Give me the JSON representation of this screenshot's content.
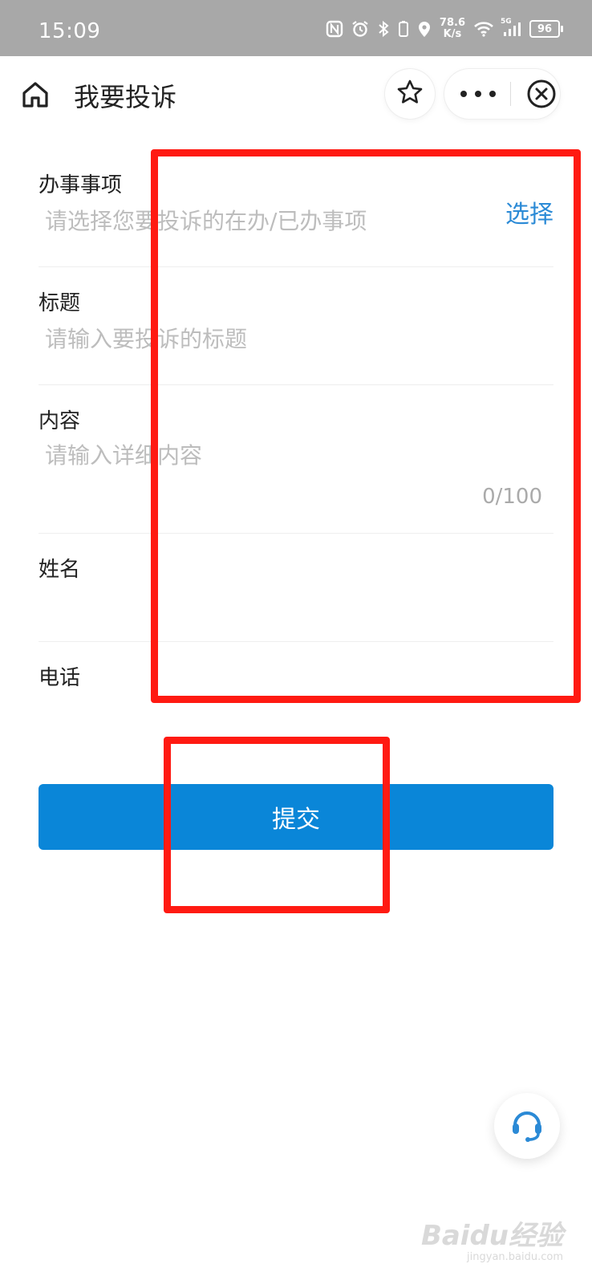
{
  "status_bar": {
    "time": "15:09",
    "network_speed_value": "78.6",
    "network_speed_unit": "K/s",
    "signal_type": "5G",
    "battery": "96"
  },
  "navbar": {
    "title": "我要投诉"
  },
  "form": {
    "matter": {
      "label": "办事事项",
      "placeholder": "请选择您要投诉的在办/已办事项",
      "select_label": "选择"
    },
    "title": {
      "label": "标题",
      "placeholder": "请输入要投诉的标题"
    },
    "content": {
      "label": "内容",
      "placeholder": "请输入详细内容",
      "counter": "0/100"
    },
    "name": {
      "label": "姓名",
      "value": ""
    },
    "phone": {
      "label": "电话",
      "value": ""
    },
    "submit_label": "提交"
  },
  "watermark": {
    "logo_text": "Baidu经验",
    "url": "jingyan.baidu.com"
  },
  "colors": {
    "accent": "#0a86d8",
    "link": "#2b8ad6",
    "annotation": "#ff1a12",
    "status_bar_bg": "#a8a8a8"
  }
}
